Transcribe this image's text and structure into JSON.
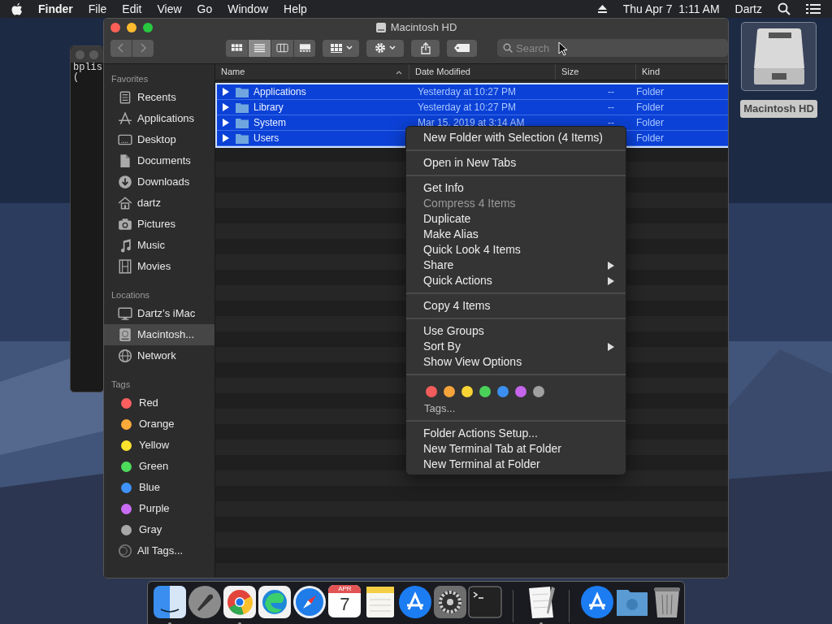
{
  "menubar": {
    "app": "Finder",
    "menus": [
      "File",
      "Edit",
      "View",
      "Go",
      "Window",
      "Help"
    ],
    "clock": "Thu Apr 7  1:11 AM",
    "user": "Dartz"
  },
  "terminal_window": {
    "lines": [
      "bplis",
      "("
    ]
  },
  "finder": {
    "title": "Macintosh HD",
    "view_buttons": [
      {
        "kind": "icons",
        "selected": false
      },
      {
        "kind": "list",
        "selected": true
      },
      {
        "kind": "columns",
        "selected": false
      },
      {
        "kind": "gallery",
        "selected": false
      }
    ],
    "search": {
      "placeholder": "Search"
    },
    "sidebar": [
      {
        "heading": "Favorites",
        "items": [
          {
            "label": "Recents",
            "kind": "recents",
            "selected": false
          },
          {
            "label": "Applications",
            "kind": "applications",
            "selected": false
          },
          {
            "label": "Desktop",
            "kind": "desktop",
            "selected": false
          },
          {
            "label": "Documents",
            "kind": "documents",
            "selected": false
          },
          {
            "label": "Downloads",
            "kind": "downloads",
            "selected": false
          },
          {
            "label": "dartz",
            "kind": "home",
            "selected": false
          },
          {
            "label": "Pictures",
            "kind": "pictures",
            "selected": false
          },
          {
            "label": "Music",
            "kind": "music",
            "selected": false
          },
          {
            "label": "Movies",
            "kind": "movies",
            "selected": false
          }
        ]
      },
      {
        "heading": "Locations",
        "items": [
          {
            "label": "Dartz’s iMac",
            "kind": "computer",
            "selected": false
          },
          {
            "label": "Macintosh...",
            "kind": "disk",
            "selected": true
          },
          {
            "label": "Network",
            "kind": "network",
            "selected": false
          }
        ]
      },
      {
        "heading": "Tags",
        "items": [
          {
            "label": "Red",
            "kind": "tag",
            "color": "#ff5f5f",
            "selected": false
          },
          {
            "label": "Orange",
            "kind": "tag",
            "color": "#ffab3a",
            "selected": false
          },
          {
            "label": "Yellow",
            "kind": "tag",
            "color": "#ffe22e",
            "selected": false
          },
          {
            "label": "Green",
            "kind": "tag",
            "color": "#4cdb5a",
            "selected": false
          },
          {
            "label": "Blue",
            "kind": "tag",
            "color": "#3f93ff",
            "selected": false
          },
          {
            "label": "Purple",
            "kind": "tag",
            "color": "#c96bf5",
            "selected": false
          },
          {
            "label": "Gray",
            "kind": "tag",
            "color": "#a8a8a8",
            "selected": false
          },
          {
            "label": "All Tags...",
            "kind": "all-tags",
            "selected": false
          }
        ]
      }
    ],
    "table": {
      "columns": [
        {
          "label": "Name",
          "sorted": true
        },
        {
          "label": "Date Modified",
          "sorted": false
        },
        {
          "label": "Size",
          "sorted": false
        },
        {
          "label": "Kind",
          "sorted": false
        }
      ],
      "rows": [
        {
          "name": "Applications",
          "date": "Yesterday at 10:27 PM",
          "size": "--",
          "kind": "Folder",
          "selected": true,
          "expanded": false
        },
        {
          "name": "Library",
          "date": "Yesterday at 10:27 PM",
          "size": "--",
          "kind": "Folder",
          "selected": true,
          "expanded": false
        },
        {
          "name": "System",
          "date": "Mar 15, 2019 at 3:14 AM",
          "size": "--",
          "kind": "Folder",
          "selected": true,
          "expanded": false
        },
        {
          "name": "Users",
          "kind": "Folder",
          "selected": true,
          "expanded": false
        }
      ]
    }
  },
  "context_menu": [
    {
      "kind": "item",
      "label": "New Folder with Selection (4 Items)",
      "disabled": false,
      "submenu": false
    },
    {
      "kind": "separator"
    },
    {
      "kind": "item",
      "label": "Open in New Tabs",
      "disabled": false,
      "submenu": false
    },
    {
      "kind": "separator"
    },
    {
      "kind": "item",
      "label": "Get Info",
      "disabled": false,
      "submenu": false
    },
    {
      "kind": "item",
      "label": "Compress 4 Items",
      "disabled": true,
      "submenu": false
    },
    {
      "kind": "item",
      "label": "Duplicate",
      "disabled": false,
      "submenu": false
    },
    {
      "kind": "item",
      "label": "Make Alias",
      "disabled": false,
      "submenu": false
    },
    {
      "kind": "item",
      "label": "Quick Look 4 Items",
      "disabled": false,
      "submenu": false
    },
    {
      "kind": "item",
      "label": "Share",
      "disabled": false,
      "submenu": true
    },
    {
      "kind": "item",
      "label": "Quick Actions",
      "disabled": false,
      "submenu": true
    },
    {
      "kind": "separator"
    },
    {
      "kind": "item",
      "label": "Copy 4 Items",
      "disabled": false,
      "submenu": false
    },
    {
      "kind": "separator"
    },
    {
      "kind": "item",
      "label": "Use Groups",
      "disabled": false,
      "submenu": false
    },
    {
      "kind": "item",
      "label": "Sort By",
      "disabled": false,
      "submenu": true
    },
    {
      "kind": "item",
      "label": "Show View Options",
      "disabled": false,
      "submenu": false
    },
    {
      "kind": "separator"
    },
    {
      "kind": "tags",
      "colors": [
        {
          "color": "#f25c5c"
        },
        {
          "color": "#f5a33b"
        },
        {
          "color": "#f7d433"
        },
        {
          "color": "#4ad15a"
        },
        {
          "color": "#3b8ff0"
        },
        {
          "color": "#c465ec"
        },
        {
          "color": "#a0a0a0"
        }
      ],
      "label": "Tags..."
    },
    {
      "kind": "separator"
    },
    {
      "kind": "item",
      "label": "Folder Actions Setup...",
      "disabled": false,
      "submenu": false
    },
    {
      "kind": "item",
      "label": "New Terminal Tab at Folder",
      "disabled": false,
      "submenu": false
    },
    {
      "kind": "item",
      "label": "New Terminal at Folder",
      "disabled": false,
      "submenu": false
    }
  ],
  "desktop_icons": [
    {
      "label": "Macintosh HD",
      "kind": "drive",
      "selected": true
    }
  ],
  "dock": [
    {
      "kind": "finder",
      "running": true
    },
    {
      "kind": "launchpad",
      "running": false
    },
    {
      "kind": "chrome",
      "running": true
    },
    {
      "kind": "edge",
      "running": false
    },
    {
      "kind": "safari",
      "running": false
    },
    {
      "kind": "calendar",
      "running": false,
      "month": "APR",
      "day": "7"
    },
    {
      "kind": "notes",
      "running": false
    },
    {
      "kind": "appstore",
      "running": false
    },
    {
      "kind": "settings",
      "running": false
    },
    {
      "kind": "terminal",
      "running": false
    },
    {
      "kind": "divider"
    },
    {
      "kind": "textedit",
      "running": true
    },
    {
      "kind": "divider"
    },
    {
      "kind": "appstore",
      "running": false
    },
    {
      "kind": "folder",
      "running": false
    },
    {
      "kind": "trash",
      "running": false
    }
  ]
}
